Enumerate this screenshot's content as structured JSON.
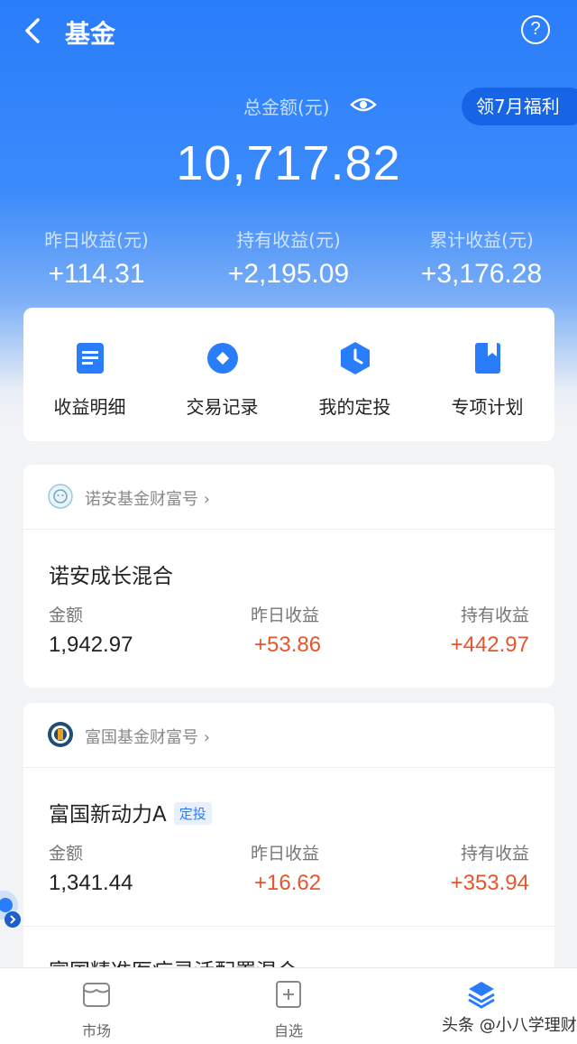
{
  "header": {
    "title": "基金",
    "back_icon": "chevron-left-icon",
    "help_label": "?"
  },
  "summary": {
    "total_label": "总金额(元)",
    "total_value": "10,717.82",
    "promo_label": "领7月福利",
    "stats": [
      {
        "label": "昨日收益(元)",
        "value": "+114.31"
      },
      {
        "label": "持有收益(元)",
        "value": "+2,195.09"
      },
      {
        "label": "累计收益(元)",
        "value": "+3,176.28"
      }
    ]
  },
  "actions": [
    {
      "label": "收益明细",
      "icon": "document-icon"
    },
    {
      "label": "交易记录",
      "icon": "record-icon"
    },
    {
      "label": "我的定投",
      "icon": "clock-icon"
    },
    {
      "label": "专项计划",
      "icon": "bookmark-icon"
    }
  ],
  "funds": [
    {
      "company": "诺安基金财富号",
      "name": "诺安成长混合",
      "tag": "",
      "amount_label": "金额",
      "amount": "1,942.97",
      "yesterday_label": "昨日收益",
      "yesterday": "+53.86",
      "holding_label": "持有收益",
      "holding": "+442.97"
    },
    {
      "company": "富国基金财富号",
      "name": "富国新动力A",
      "tag": "定投",
      "amount_label": "金额",
      "amount": "1,341.44",
      "yesterday_label": "昨日收益",
      "yesterday": "+16.62",
      "holding_label": "持有收益",
      "holding": "+353.94"
    }
  ],
  "partial_fund_name": "富国精准医疗灵活配置混合",
  "bottom_nav": [
    {
      "label": "市场",
      "icon": "market-icon"
    },
    {
      "label": "自选",
      "icon": "add-watchlist-icon"
    },
    {
      "label": "",
      "icon": "layers-icon"
    }
  ],
  "watermark": "头条 @小八学理财",
  "colors": {
    "primary": "#2a7dfa",
    "gain": "#e4572e"
  }
}
